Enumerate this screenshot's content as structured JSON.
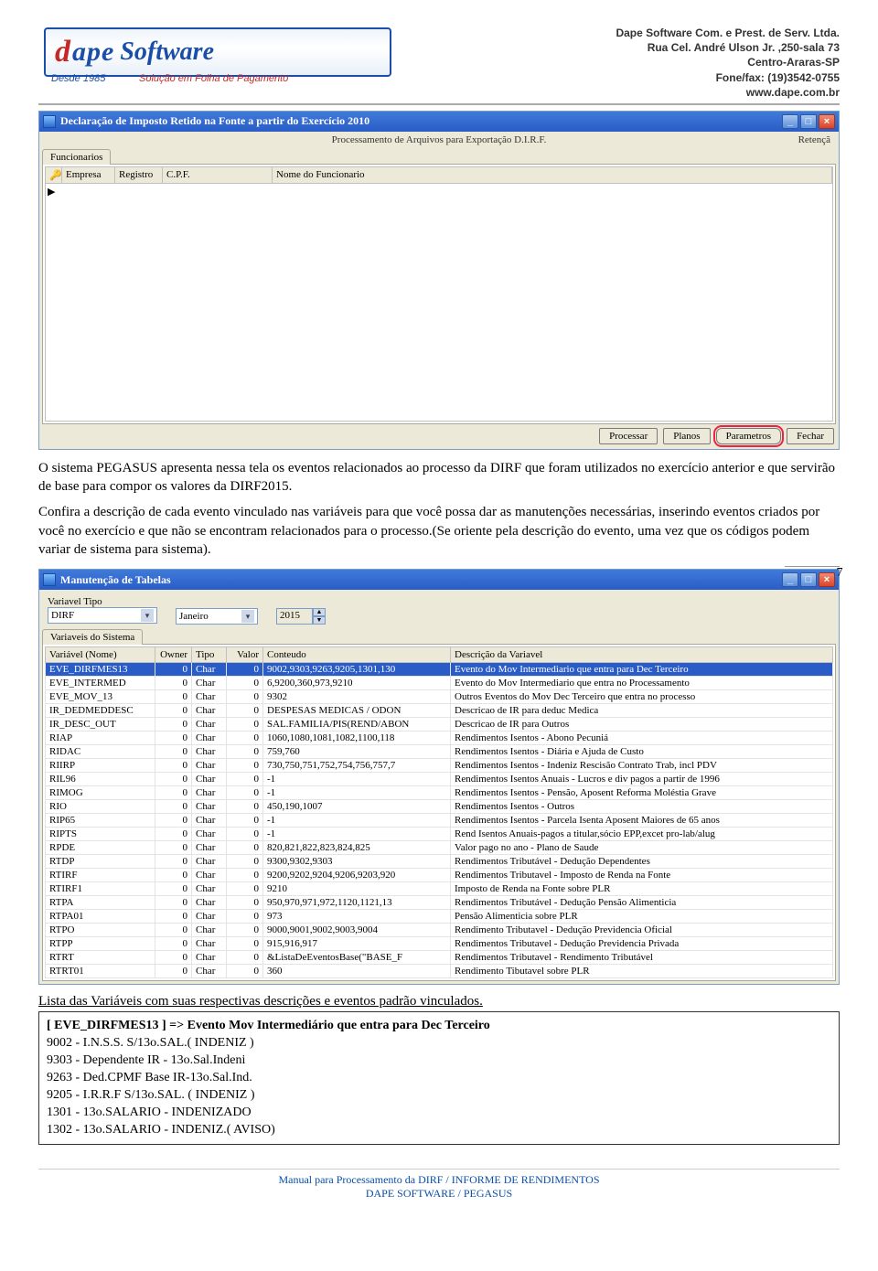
{
  "header": {
    "logo_d": "d",
    "logo_ape": "ape",
    "logo_soft": "Software",
    "logo_since": "Desde 1985",
    "logo_tag": "Solução em Folha de Pagamento",
    "company_lines": [
      "Dape Software Com. e Prest. de Serv. Ltda.",
      "Rua Cel. André Ulson Jr. ,250-sala 73",
      "Centro-Araras-SP",
      "Fone/fax: (19)3542-0755",
      "www.dape.com.br"
    ]
  },
  "win1": {
    "title": "Declaração de Imposto Retido na Fonte a partir do Exercício 2010",
    "subtitle": "Processamento de Arquivos para Exportação D.I.R.F.",
    "right_label": "Retençã",
    "tab": "Funcionarios",
    "cols": {
      "key": "🔑",
      "empresa": "Empresa",
      "registro": "Registro",
      "cpf": "C.P.F.",
      "nome": "Nome do Funcionario"
    },
    "row_marker": "▶",
    "buttons": {
      "processar": "Processar",
      "planos": "Planos",
      "parametros": "Parametros",
      "fechar": "Fechar"
    }
  },
  "para1": "O sistema PEGASUS apresenta nessa tela os eventos relacionados ao processo da DIRF que foram utilizados no exercício anterior e que servirão de base para compor os valores da DIRF2015.",
  "para2": "Confira a descrição de cada evento vinculado nas variáveis para que você possa dar as manutenções necessárias, inserindo eventos criados por você no exercício e que não se encontram relacionados para o processo.(Se oriente pela descrição do evento, uma vez que os códigos podem variar de sistema para sistema).",
  "page_number": "7",
  "win2": {
    "title": "Manutenção de Tabelas",
    "var_tipo_label": "Variavel Tipo",
    "var_tipo_value": "DIRF",
    "month": "Janeiro",
    "year": "2015",
    "tab": "Variaveis do Sistema",
    "cols": [
      "Variável (Nome)",
      "Owner",
      "Tipo",
      "Valor",
      "Conteudo",
      "Descrição da Variavel"
    ],
    "rows": [
      {
        "sel": true,
        "n": "EVE_DIRFMES13",
        "o": "0",
        "t": "Char",
        "v": "0",
        "c": "9002,9303,9263,9205,1301,130",
        "d": "Evento do Mov Intermediario que entra para Dec Terceiro"
      },
      {
        "sel": false,
        "n": "EVE_INTERMED",
        "o": "0",
        "t": "Char",
        "v": "0",
        "c": "6,9200,360,973,9210",
        "d": "Evento do Mov Intermediario que entra no Processamento"
      },
      {
        "sel": false,
        "n": "EVE_MOV_13",
        "o": "0",
        "t": "Char",
        "v": "0",
        "c": "9302",
        "d": "Outros Eventos do Mov Dec Terceiro que entra no processo"
      },
      {
        "sel": false,
        "n": "IR_DEDMEDDESC",
        "o": "0",
        "t": "Char",
        "v": "0",
        "c": "DESPESAS MEDICAS / ODON",
        "d": "Descricao de IR para deduc Medica"
      },
      {
        "sel": false,
        "n": "IR_DESC_OUT",
        "o": "0",
        "t": "Char",
        "v": "0",
        "c": "SAL.FAMILIA/PIS(REND/ABON",
        "d": "Descricao de IR para Outros"
      },
      {
        "sel": false,
        "n": "RIAP",
        "o": "0",
        "t": "Char",
        "v": "0",
        "c": "1060,1080,1081,1082,1100,118",
        "d": "Rendimentos Isentos - Abono Pecuniá"
      },
      {
        "sel": false,
        "n": "RIDAC",
        "o": "0",
        "t": "Char",
        "v": "0",
        "c": "759,760",
        "d": "Rendimentos Isentos - Diária e Ajuda de Custo"
      },
      {
        "sel": false,
        "n": "RIIRP",
        "o": "0",
        "t": "Char",
        "v": "0",
        "c": "730,750,751,752,754,756,757,7",
        "d": "Rendimentos Isentos - Indeniz Rescisão Contrato Trab, incl PDV"
      },
      {
        "sel": false,
        "n": "RIL96",
        "o": "0",
        "t": "Char",
        "v": "0",
        "c": "-1",
        "d": "Rendimentos Isentos Anuais - Lucros e div pagos a partir de 1996"
      },
      {
        "sel": false,
        "n": "RIMOG",
        "o": "0",
        "t": "Char",
        "v": "0",
        "c": "-1",
        "d": "Rendimentos Isentos - Pensão, Aposent Reforma Moléstia Grave"
      },
      {
        "sel": false,
        "n": "RIO",
        "o": "0",
        "t": "Char",
        "v": "0",
        "c": "450,190,1007",
        "d": "Rendimentos Isentos - Outros"
      },
      {
        "sel": false,
        "n": "RIP65",
        "o": "0",
        "t": "Char",
        "v": "0",
        "c": "-1",
        "d": "Rendimentos Isentos - Parcela Isenta Aposent Maiores de 65 anos"
      },
      {
        "sel": false,
        "n": "RIPTS",
        "o": "0",
        "t": "Char",
        "v": "0",
        "c": "-1",
        "d": "Rend Isentos Anuais-pagos a titular,sócio EPP,excet pro-lab/alug"
      },
      {
        "sel": false,
        "n": "RPDE",
        "o": "0",
        "t": "Char",
        "v": "0",
        "c": "820,821,822,823,824,825",
        "d": "Valor pago no ano - Plano de Saude"
      },
      {
        "sel": false,
        "n": "RTDP",
        "o": "0",
        "t": "Char",
        "v": "0",
        "c": "9300,9302,9303",
        "d": "Rendimentos Tributável - Dedução Dependentes"
      },
      {
        "sel": false,
        "n": "RTIRF",
        "o": "0",
        "t": "Char",
        "v": "0",
        "c": "9200,9202,9204,9206,9203,920",
        "d": "Rendimentos Tributavel - Imposto de Renda na Fonte"
      },
      {
        "sel": false,
        "n": "RTIRF1",
        "o": "0",
        "t": "Char",
        "v": "0",
        "c": "9210",
        "d": "Imposto de Renda na Fonte sobre PLR"
      },
      {
        "sel": false,
        "n": "RTPA",
        "o": "0",
        "t": "Char",
        "v": "0",
        "c": "950,970,971,972,1120,1121,13",
        "d": "Rendimentos Tributável - Dedução Pensão Alimenticia"
      },
      {
        "sel": false,
        "n": "RTPA01",
        "o": "0",
        "t": "Char",
        "v": "0",
        "c": "973",
        "d": "Pensão Alimenticia sobre PLR"
      },
      {
        "sel": false,
        "n": "RTPO",
        "o": "0",
        "t": "Char",
        "v": "0",
        "c": "9000,9001,9002,9003,9004",
        "d": "Rendimento Tributavel - Dedução Previdencia Oficial"
      },
      {
        "sel": false,
        "n": "RTPP",
        "o": "0",
        "t": "Char",
        "v": "0",
        "c": "915,916,917",
        "d": "Rendimentos Tributavel - Dedução Previdencia Privada"
      },
      {
        "sel": false,
        "n": "RTRT",
        "o": "0",
        "t": "Char",
        "v": "0",
        "c": "&ListaDeEventosBase(\"BASE_F",
        "d": "Rendimentos Tributavel - Rendimento Tributável"
      },
      {
        "sel": false,
        "n": "RTRT01",
        "o": "0",
        "t": "Char",
        "v": "0",
        "c": "360",
        "d": "Rendimento Tibutavel sobre PLR"
      }
    ]
  },
  "list_title": "Lista das Variáveis com suas respectivas descrições e eventos padrão vinculados.",
  "codebox": {
    "hdr": "[ EVE_DIRFMES13 ] => Evento Mov Intermediário que entra para Dec Terceiro",
    "lines": [
      "9002 - I.N.S.S. S/13o.SAL.( INDENIZ )",
      "9303 - Dependente IR - 13o.Sal.Indeni",
      "9263 - Ded.CPMF Base IR-13o.Sal.Ind.",
      "9205 - I.R.R.F S/13o.SAL. ( INDENIZ )",
      "1301 - 13o.SALARIO - INDENIZADO",
      "1302 - 13o.SALARIO - INDENIZ.( AVISO)"
    ]
  },
  "footer": {
    "l1": "Manual para Processamento da DIRF / INFORME DE RENDIMENTOS",
    "l2": "DAPE SOFTWARE / PEGASUS"
  }
}
